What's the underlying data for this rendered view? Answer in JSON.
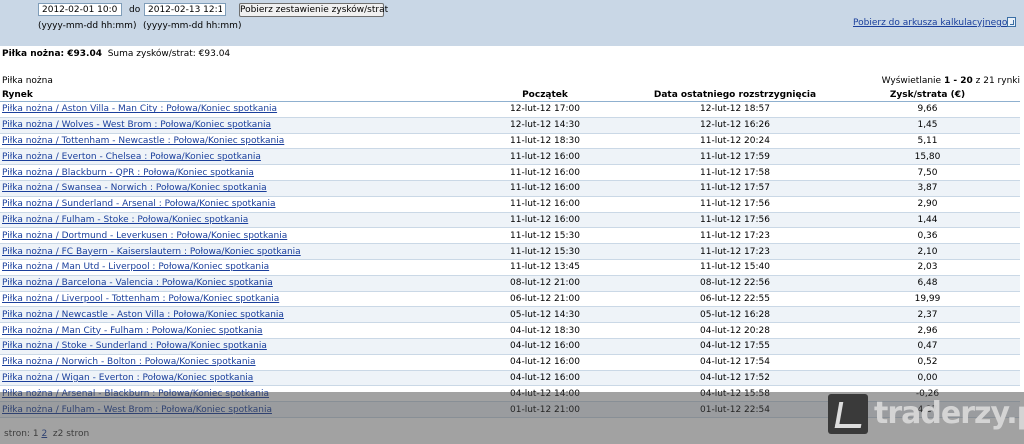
{
  "filter": {
    "from_date": "2012-02-01 10:00",
    "do_label": "do",
    "to_date": "2012-02-13 12:15",
    "button_label": "Pobierz zestawienie zysków/strat",
    "date_format_from": "(yyyy-mm-dd hh:mm)",
    "date_format_to": "(yyyy-mm-dd hh:mm)",
    "export_link": "Pobierz do arkusza kalkulacyjnego"
  },
  "summary": {
    "sport_label": "Piłka nożna: €93.04",
    "total_label": "Suma zysków/strat: €93.04"
  },
  "section": {
    "title": "Piłka nożna",
    "display_prefix": "Wyświetlanie",
    "display_range": "1 - 20",
    "display_suffix": "z 21 rynki"
  },
  "table": {
    "headers": {
      "market": "Rynek",
      "start": "Początek",
      "settled": "Data ostatniego rozstrzygnięcia",
      "pl": "Zysk/strata (€)"
    },
    "rows": [
      {
        "market": "Piłka nożna / Aston Villa - Man City : Połowa/Koniec spotkania",
        "start": "12-lut-12 17:00",
        "settled": "12-lut-12 18:57",
        "pl": "9,66"
      },
      {
        "market": "Piłka nożna / Wolves - West Brom : Połowa/Koniec spotkania",
        "start": "12-lut-12 14:30",
        "settled": "12-lut-12 16:26",
        "pl": "1,45"
      },
      {
        "market": "Piłka nożna / Tottenham - Newcastle : Połowa/Koniec spotkania",
        "start": "11-lut-12 18:30",
        "settled": "11-lut-12 20:24",
        "pl": "5,11"
      },
      {
        "market": "Piłka nożna / Everton - Chelsea : Połowa/Koniec spotkania",
        "start": "11-lut-12 16:00",
        "settled": "11-lut-12 17:59",
        "pl": "15,80"
      },
      {
        "market": "Piłka nożna / Blackburn - QPR : Połowa/Koniec spotkania",
        "start": "11-lut-12 16:00",
        "settled": "11-lut-12 17:58",
        "pl": "7,50"
      },
      {
        "market": "Piłka nożna / Swansea - Norwich : Połowa/Koniec spotkania",
        "start": "11-lut-12 16:00",
        "settled": "11-lut-12 17:57",
        "pl": "3,87"
      },
      {
        "market": "Piłka nożna / Sunderland - Arsenal : Połowa/Koniec spotkania",
        "start": "11-lut-12 16:00",
        "settled": "11-lut-12 17:56",
        "pl": "2,90"
      },
      {
        "market": "Piłka nożna / Fulham - Stoke : Połowa/Koniec spotkania",
        "start": "11-lut-12 16:00",
        "settled": "11-lut-12 17:56",
        "pl": "1,44"
      },
      {
        "market": "Piłka nożna / Dortmund - Leverkusen : Połowa/Koniec spotkania",
        "start": "11-lut-12 15:30",
        "settled": "11-lut-12 17:23",
        "pl": "0,36"
      },
      {
        "market": "Piłka nożna / FC Bayern - Kaiserslautern : Połowa/Koniec spotkania",
        "start": "11-lut-12 15:30",
        "settled": "11-lut-12 17:23",
        "pl": "2,10"
      },
      {
        "market": "Piłka nożna / Man Utd - Liverpool : Połowa/Koniec spotkania",
        "start": "11-lut-12 13:45",
        "settled": "11-lut-12 15:40",
        "pl": "2,03"
      },
      {
        "market": "Piłka nożna / Barcelona - Valencia : Połowa/Koniec spotkania",
        "start": "08-lut-12 21:00",
        "settled": "08-lut-12 22:56",
        "pl": "6,48"
      },
      {
        "market": "Piłka nożna / Liverpool - Tottenham : Połowa/Koniec spotkania",
        "start": "06-lut-12 21:00",
        "settled": "06-lut-12 22:55",
        "pl": "19,99"
      },
      {
        "market": "Piłka nożna / Newcastle - Aston Villa : Połowa/Koniec spotkania",
        "start": "05-lut-12 14:30",
        "settled": "05-lut-12 16:28",
        "pl": "2,37"
      },
      {
        "market": "Piłka nożna / Man City - Fulham : Połowa/Koniec spotkania",
        "start": "04-lut-12 18:30",
        "settled": "04-lut-12 20:28",
        "pl": "2,96"
      },
      {
        "market": "Piłka nożna / Stoke - Sunderland : Połowa/Koniec spotkania",
        "start": "04-lut-12 16:00",
        "settled": "04-lut-12 17:55",
        "pl": "0,47"
      },
      {
        "market": "Piłka nożna / Norwich - Bolton : Połowa/Koniec spotkania",
        "start": "04-lut-12 16:00",
        "settled": "04-lut-12 17:54",
        "pl": "0,52"
      },
      {
        "market": "Piłka nożna / Wigan - Everton : Połowa/Koniec spotkania",
        "start": "04-lut-12 16:00",
        "settled": "04-lut-12 17:52",
        "pl": "0,00"
      },
      {
        "market": "Piłka nożna / Arsenal - Blackburn : Połowa/Koniec spotkania",
        "start": "04-lut-12 14:00",
        "settled": "04-lut-12 15:58",
        "pl": "-0,26"
      },
      {
        "market": "Piłka nożna / Fulham - West Brom : Połowa/Koniec spotkania",
        "start": "01-lut-12 21:00",
        "settled": "01-lut-12 22:54",
        "pl": "4,27"
      }
    ]
  },
  "pager": {
    "label": "stron:",
    "page1": "1",
    "page2": "2",
    "suffix": "z2 stron"
  },
  "watermark": {
    "text": "traderzy.pl"
  }
}
